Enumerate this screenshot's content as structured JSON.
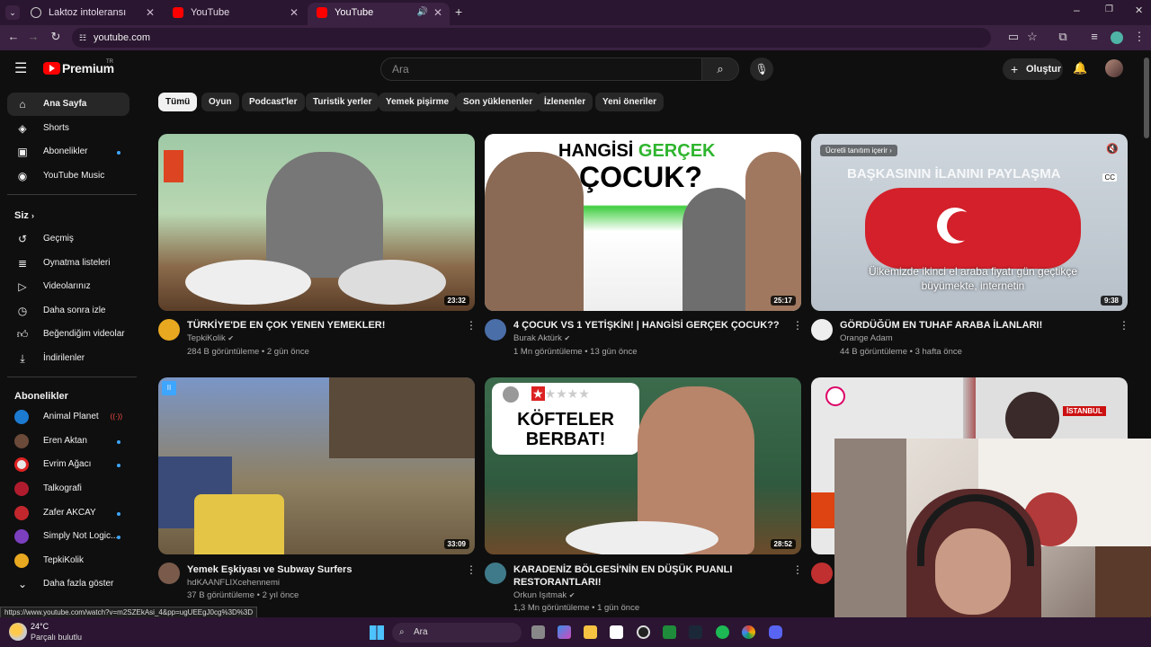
{
  "browser": {
    "tabs": [
      {
        "title": "Laktoz intoleransı dağılımı",
        "active": false
      },
      {
        "title": "YouTube",
        "active": false
      },
      {
        "title": "YouTube",
        "active": true
      }
    ],
    "url": "youtube.com"
  },
  "header": {
    "logo_text": "Premium",
    "logo_region": "TR",
    "search_placeholder": "Ara",
    "create_label": "Oluştur"
  },
  "chips": [
    "Tümü",
    "Oyun",
    "Podcast'ler",
    "Turistik yerler",
    "Yemek pişirme",
    "Son yüklenenler",
    "İzlenenler",
    "Yeni öneriler"
  ],
  "sidebar": {
    "main": [
      "Ana Sayfa",
      "Shorts",
      "Abonelikler",
      "YouTube Music"
    ],
    "you_heading": "Siz",
    "you_items": [
      "Geçmiş",
      "Oynatma listeleri",
      "Videolarınız",
      "Daha sonra izle",
      "Beğendiğim videolar",
      "İndirilenler"
    ],
    "subs_heading": "Abonelikler",
    "subs": [
      "Animal Planet",
      "Eren Aktan",
      "Evrim Ağacı",
      "Talkografi",
      "Zafer AKCAY",
      "Simply Not Logic...",
      "TepkiKolik"
    ],
    "show_more": "Daha fazla göster"
  },
  "videos": [
    {
      "title": "TÜRKİYE'DE EN ÇOK YENEN YEMEKLER!",
      "channel": "TepkiKolik",
      "meta": "284 B görüntüleme • 2 gün önce",
      "duration": "23:32"
    },
    {
      "title": "4 ÇOCUK VS 1 YETİŞKİN! | HANGİSİ GERÇEK ÇOCUK??",
      "channel": "Burak Aktürk",
      "meta": "1 Mn görüntüleme • 13 gün önce",
      "duration": "25:17",
      "thumb_text_1": "HANGİSİ",
      "thumb_text_2": "GERÇEK",
      "thumb_text_3": "ÇOCUK?"
    },
    {
      "title": "GÖRDÜĞÜM EN TUHAF ARABA İLANLARI!",
      "channel": "Orange Adam",
      "meta": "44 B görüntüleme • 3 hafta önce",
      "duration": "9:38",
      "promo": "Ücretli tanıtım içerir",
      "overlay_text": "BAŞKASININ İLANINI PAYLAŞMA",
      "subtitle": "Ülkemizde ikinci el araba fiyatı gün geçtikçe büyümekte, internetin"
    },
    {
      "title": "Yemek Eşkiyası ve Subway Surfers",
      "channel": "hdKAANFLIXcehennemi",
      "meta": "37 B görüntüleme • 2 yıl önce",
      "duration": "33:09"
    },
    {
      "title": "KARADENİZ BÖLGESİ'NİN EN DÜŞÜK PUANLI RESTORANTLARI!",
      "channel": "Orkun Işıtmak",
      "meta": "1,3 Mn görüntüleme • 1 gün önce",
      "duration": "28:52",
      "thumb_text_1": "KÖFTELER",
      "thumb_text_2": "BERBAT!"
    },
    {
      "title": "",
      "channel": "",
      "meta": "",
      "duration": "",
      "badge": "İSTANBUL"
    }
  ],
  "statusbar_url": "https://www.youtube.com/watch?v=m2SZEkAsi_4&pp=ugUEEgJ0cg%3D%3D",
  "taskbar": {
    "weather_temp": "24°C",
    "weather_desc": "Parçalı bulutlu",
    "search_label": "Ara"
  },
  "colors": {
    "yt_red": "#ff0000",
    "bg": "#0f0f0f",
    "chip": "#272727",
    "browser_frame": "#3b2142"
  }
}
